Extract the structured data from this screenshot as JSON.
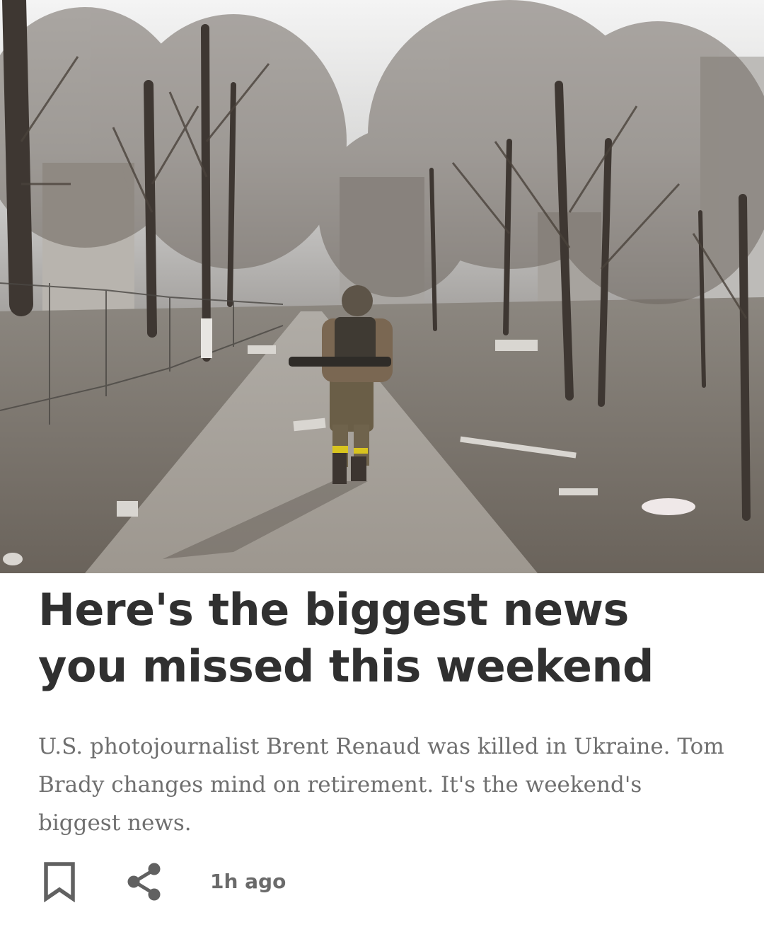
{
  "article": {
    "image": {
      "icon": "war-zone-photo",
      "alt": ""
    },
    "headline": "Here's the biggest news you missed this weekend",
    "summary": "U.S. photojournalist Brent Renaud was killed in Ukraine. Tom Brady changes mind on retirement. It's the weekend's biggest news.",
    "timestamp": "1h ago"
  },
  "actions": {
    "bookmark_icon": "bookmark-icon",
    "share_icon": "share-icon"
  },
  "colors": {
    "headline": "#303030",
    "summary": "#6f6f6f",
    "timestamp": "#6a6a6a",
    "icon": "#616161"
  }
}
